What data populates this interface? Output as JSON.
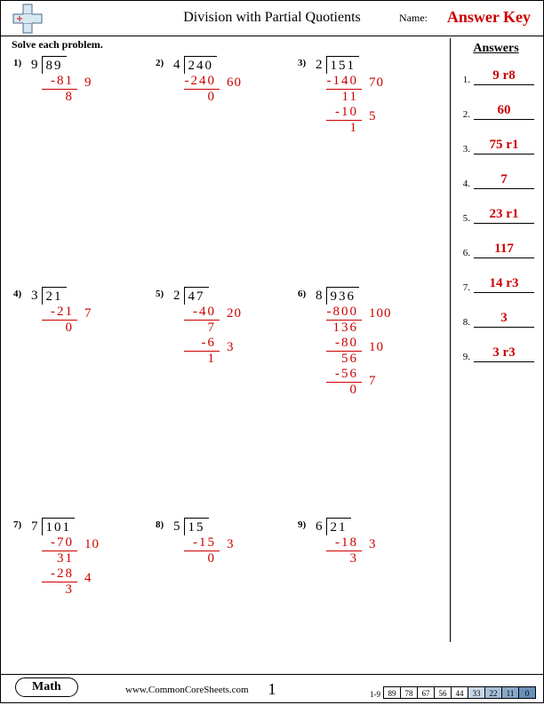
{
  "header": {
    "title": "Division with Partial Quotients",
    "name_label": "Name:",
    "answer_key": "Answer Key"
  },
  "instructions": "Solve each problem.",
  "answers_heading": "Answers",
  "answers": [
    {
      "n": "1.",
      "v": "9 r8"
    },
    {
      "n": "2.",
      "v": "60"
    },
    {
      "n": "3.",
      "v": "75 r1"
    },
    {
      "n": "4.",
      "v": "7"
    },
    {
      "n": "5.",
      "v": "23 r1"
    },
    {
      "n": "6.",
      "v": "117"
    },
    {
      "n": "7.",
      "v": "14 r3"
    },
    {
      "n": "8.",
      "v": "3"
    },
    {
      "n": "9.",
      "v": "3 r3"
    }
  ],
  "problems": [
    {
      "num": "1)",
      "divisor": "9",
      "dividend": "89",
      "steps": [
        {
          "sub": "-81",
          "res": "8",
          "pq": "9"
        }
      ]
    },
    {
      "num": "2)",
      "divisor": "4",
      "dividend": "240",
      "steps": [
        {
          "sub": "-240",
          "res": "0",
          "pq": "60"
        }
      ]
    },
    {
      "num": "3)",
      "divisor": "2",
      "dividend": "151",
      "steps": [
        {
          "sub": "-140",
          "res": "11",
          "pq": "70"
        },
        {
          "sub": "-10",
          "res": "1",
          "pq": "5"
        }
      ]
    },
    {
      "num": "4)",
      "divisor": "3",
      "dividend": "21",
      "steps": [
        {
          "sub": "-21",
          "res": "0",
          "pq": "7"
        }
      ]
    },
    {
      "num": "5)",
      "divisor": "2",
      "dividend": "47",
      "steps": [
        {
          "sub": "-40",
          "res": "7",
          "pq": "20"
        },
        {
          "sub": "-6",
          "res": "1",
          "pq": "3"
        }
      ]
    },
    {
      "num": "6)",
      "divisor": "8",
      "dividend": "936",
      "steps": [
        {
          "sub": "-800",
          "res": "136",
          "pq": "100"
        },
        {
          "sub": "-80",
          "res": "56",
          "pq": "10"
        },
        {
          "sub": "-56",
          "res": "0",
          "pq": "7"
        }
      ]
    },
    {
      "num": "7)",
      "divisor": "7",
      "dividend": "101",
      "steps": [
        {
          "sub": "-70",
          "res": "31",
          "pq": "10"
        },
        {
          "sub": "-28",
          "res": "3",
          "pq": "4"
        }
      ]
    },
    {
      "num": "8)",
      "divisor": "5",
      "dividend": "15",
      "steps": [
        {
          "sub": "-15",
          "res": "0",
          "pq": "3"
        }
      ]
    },
    {
      "num": "9)",
      "divisor": "6",
      "dividend": "21",
      "steps": [
        {
          "sub": "-18",
          "res": "3",
          "pq": "3"
        }
      ]
    }
  ],
  "footer": {
    "subject": "Math",
    "site": "www.CommonCoreSheets.com",
    "page": "1",
    "score_label": "1-9",
    "scores": [
      "89",
      "78",
      "67",
      "56",
      "44",
      "33",
      "22",
      "11",
      "0"
    ]
  }
}
